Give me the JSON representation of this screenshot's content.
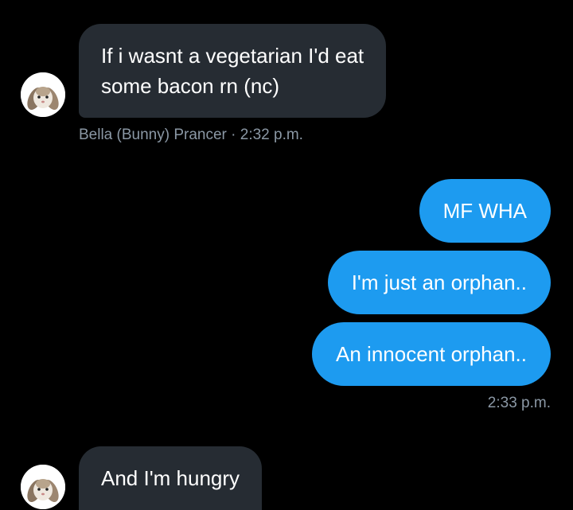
{
  "messages": [
    {
      "direction": "received",
      "lines": [
        "If i wasnt a vegetarian I'd eat",
        "some bacon rn (nc)"
      ],
      "meta": "Bella (Bunny) Prancer · 2:32 p.m."
    },
    {
      "direction": "sent",
      "text": "MF WHA"
    },
    {
      "direction": "sent",
      "text": "I'm just an orphan.."
    },
    {
      "direction": "sent",
      "text": "An innocent orphan..",
      "meta": "2:33 p.m."
    },
    {
      "direction": "received",
      "text": "And I'm hungry"
    }
  ],
  "colors": {
    "background": "#000000",
    "received_bubble": "#262c33",
    "sent_bubble": "#1d9bf0",
    "meta_text": "#8b98a5"
  },
  "icons": {
    "avatar": "bunny-avatar-icon"
  }
}
